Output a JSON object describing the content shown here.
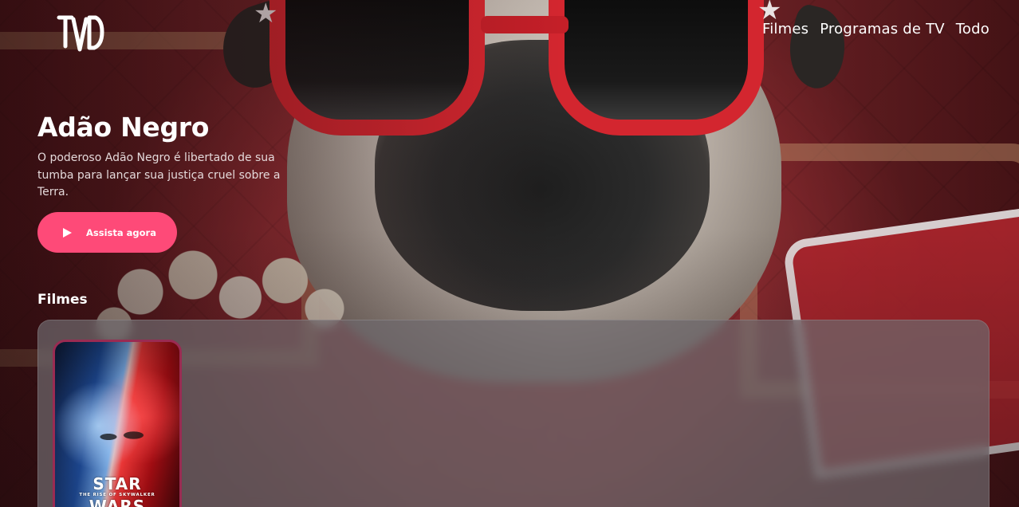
{
  "header": {
    "logo_text": "TVD",
    "nav": [
      {
        "label": "Filmes"
      },
      {
        "label": "Programas de TV"
      },
      {
        "label": "Todo"
      }
    ]
  },
  "hero": {
    "title": "Adão Negro",
    "description": "O poderoso Adão Negro é libertado de sua tumba para lançar sua justiça cruel sobre a Terra.",
    "cta_label": "Assista agora",
    "cta_icon": "play-icon",
    "background_image": "pug-with-sunglasses-in-cinema"
  },
  "sections": [
    {
      "title": "Filmes",
      "items": [
        {
          "poster_title_line1": "STAR",
          "poster_subtitle": "THE RISE OF SKYWALKER",
          "poster_title_line2": "WARS"
        }
      ]
    }
  ],
  "colors": {
    "accent": "#fe4a78",
    "poster_border": "#9a2b52",
    "text": "#ffffff"
  }
}
